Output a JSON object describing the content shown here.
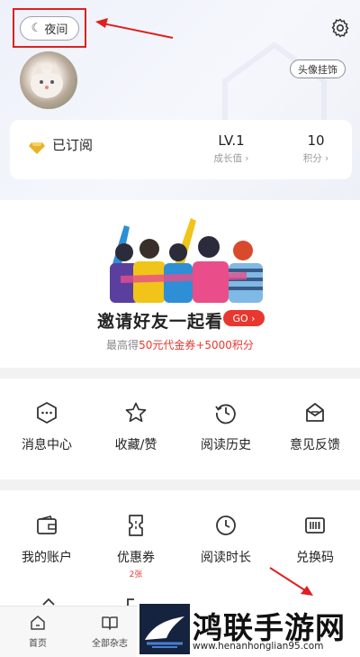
{
  "header": {
    "night_label": "夜间",
    "pendant_label": "头像挂饰"
  },
  "stats": {
    "subscribed_label": "已订阅",
    "level_value": "LV.1",
    "level_label": "成长值 ›",
    "points_value": "10",
    "points_label": "积分 ›"
  },
  "invite": {
    "title": "邀请好友一起看",
    "go_label": "GO ›",
    "sub_prefix": "最高得",
    "sub_highlight": "50元代金券+5000积分"
  },
  "grid1": [
    {
      "label": "消息中心",
      "icon": "message-icon"
    },
    {
      "label": "收藏/赞",
      "icon": "star-icon"
    },
    {
      "label": "阅读历史",
      "icon": "history-icon"
    },
    {
      "label": "意见反馈",
      "icon": "feedback-icon"
    }
  ],
  "grid2": [
    {
      "label": "我的账户",
      "icon": "wallet-icon"
    },
    {
      "label": "优惠券",
      "icon": "coupon-icon",
      "badge": "2张"
    },
    {
      "label": "阅读时长",
      "icon": "clock-icon"
    },
    {
      "label": "兑换码",
      "icon": "barcode-icon"
    }
  ],
  "tabbar": [
    {
      "label": "首页",
      "icon": "home-icon"
    },
    {
      "label": "全部杂志",
      "icon": "book-icon"
    }
  ],
  "watermark": {
    "title": "鸿联手游网",
    "url": "www.henanhonglian95.com"
  },
  "colors": {
    "accent_red": "#e8372f",
    "annotation_red": "#e02020",
    "header_bg": "#eef1fa"
  }
}
